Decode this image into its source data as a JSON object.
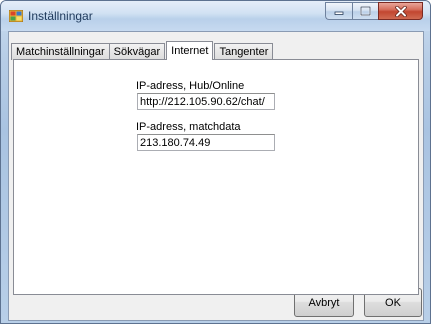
{
  "window": {
    "title": "Inställningar"
  },
  "caption_buttons": {
    "minimize_icon": "minimize-icon",
    "maximize_icon": "maximize-icon",
    "close_icon": "close-icon"
  },
  "tabs": [
    {
      "label": "Matchinställningar",
      "active": false
    },
    {
      "label": "Sökvägar",
      "active": false
    },
    {
      "label": "Internet",
      "active": true
    },
    {
      "label": "Tangenter",
      "active": false
    }
  ],
  "internet": {
    "hub_label": "IP-adress, Hub/Online",
    "hub_value": "http://212.105.90.62/chat/",
    "match_label": "IP-adress, matchdata",
    "match_value": "213.180.74.49"
  },
  "buttons": {
    "cancel": "Avbryt",
    "ok": "OK"
  },
  "colors": {
    "accent_title": "#1e395b",
    "close_button": "#c24630"
  }
}
